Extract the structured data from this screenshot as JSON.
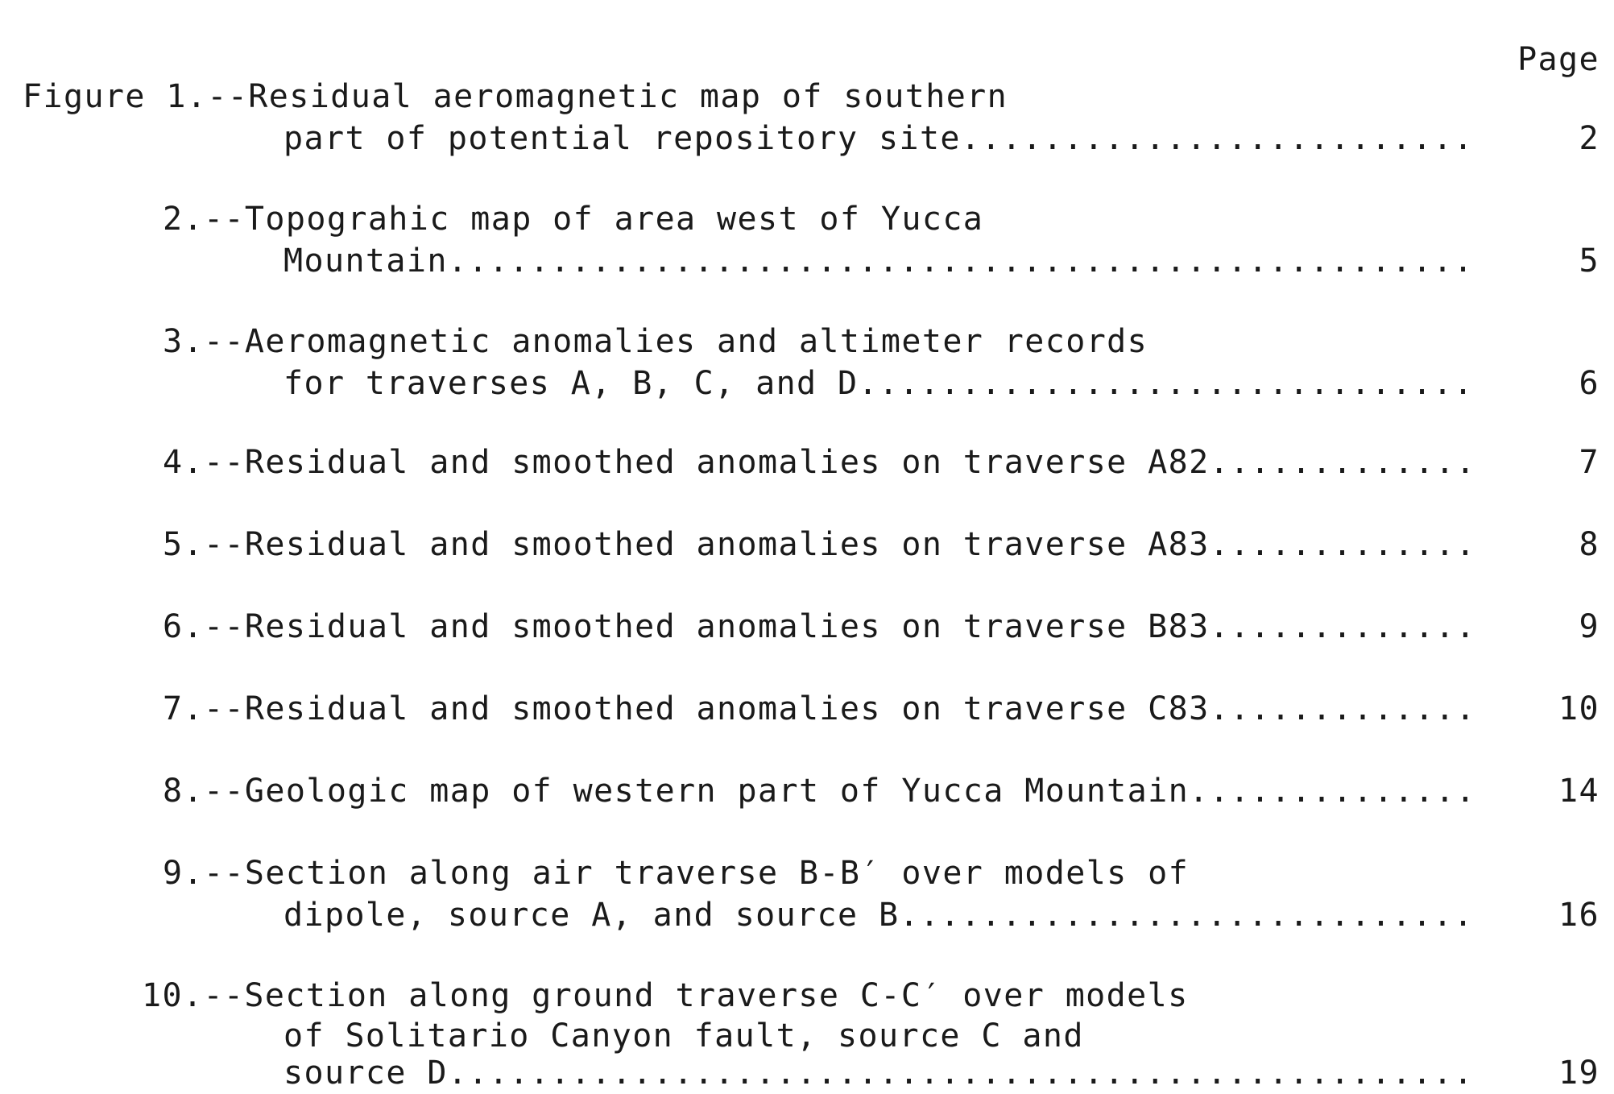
{
  "header": {
    "page_label": "Page"
  },
  "entries": [
    {
      "lead": "Figure 1.--Residual aeromagnetic map of southern",
      "cont": [
        "part of potential repository site"
      ],
      "page": "2"
    },
    {
      "lead": "2.--Topograhic map of area west of Yucca",
      "cont": [
        "Mountain"
      ],
      "page": "5"
    },
    {
      "lead": "3.--Aeromagnetic anomalies and altimeter records",
      "cont": [
        "for traverses A, B, C, and D"
      ],
      "page": "6"
    },
    {
      "lead": "4.--Residual and smoothed anomalies on traverse A82",
      "cont": [],
      "page": "7"
    },
    {
      "lead": "5.--Residual and smoothed anomalies on traverse A83",
      "cont": [],
      "page": "8"
    },
    {
      "lead": "6.--Residual and smoothed anomalies on traverse B83",
      "cont": [],
      "page": "9"
    },
    {
      "lead": "7.--Residual and smoothed anomalies on traverse C83",
      "cont": [],
      "page": "10"
    },
    {
      "lead": "8.--Geologic map of western part of Yucca Mountain",
      "cont": [],
      "page": "14"
    },
    {
      "lead": "9.--Section along air traverse B-B′ over models of",
      "cont": [
        "dipole, source A, and source B"
      ],
      "page": "16"
    },
    {
      "lead": "10.--Section along ground traverse C-C′ over models",
      "cont": [
        "of Solitario Canyon fault, source C and",
        "source D"
      ],
      "page": "19"
    }
  ]
}
